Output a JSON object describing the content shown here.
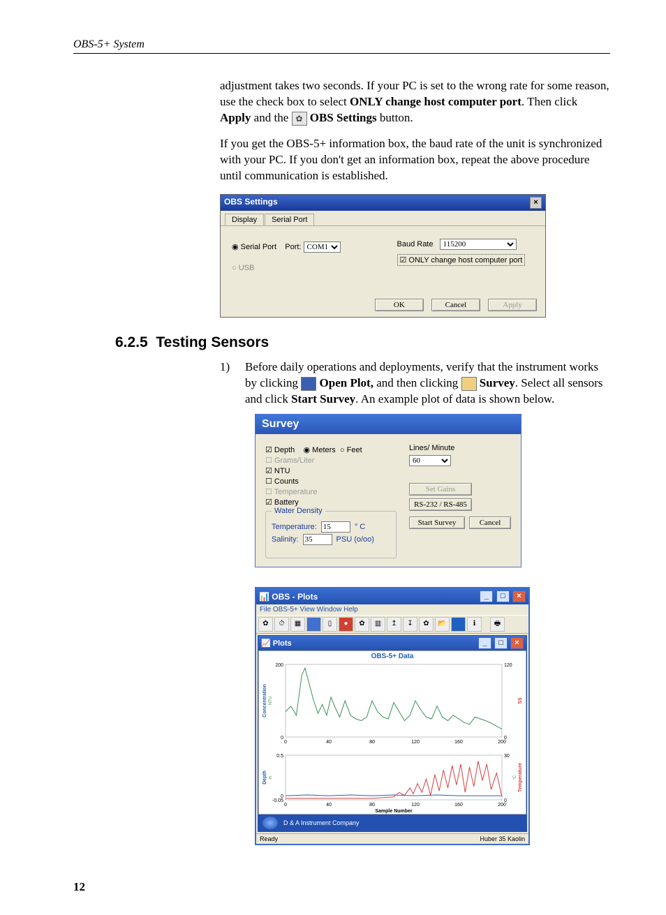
{
  "running_head": "OBS-5+ System",
  "para1_a": "adjustment takes two seconds.  If your PC is set to the wrong rate for some reason, use the check box to select ",
  "para1_b": "ONLY change host computer port",
  "para1_c": ".  Then click ",
  "para1_d": "Apply",
  "para1_e": " and the ",
  "para1_f": "OBS Settings",
  "para1_g": " button.",
  "para2": "If you get the OBS-5+ information box, the baud rate of the unit is synchronized with your PC.  If you don't get an information box, repeat the above procedure until communication is established.",
  "section_num": "6.2.5",
  "section_title": "Testing Sensors",
  "list1_num": "1)",
  "list1_a": "Before daily operations and deployments, verify that the instrument works by clicking ",
  "list1_b": "Open Plot,",
  "list1_c": " and then clicking ",
  "list1_d": "Survey",
  "list1_e": ".  Select all sensors and click ",
  "list1_f": "Start Survey",
  "list1_g": ".  An example plot of data is shown below.",
  "page_number": "12",
  "obs": {
    "title": "OBS Settings",
    "tab1": "Display",
    "tab2": "Serial Port",
    "r_serial": "Serial Port",
    "port_label": "Port:",
    "port_value": "COM1",
    "r_usb": "USB",
    "baud_label": "Baud Rate",
    "baud_value": "115200",
    "only_chk": "ONLY change host computer port",
    "ok": "OK",
    "cancel": "Cancel",
    "apply": "Apply"
  },
  "survey": {
    "title": "Survey",
    "depth": "Depth",
    "meters": "Meters",
    "feet": "Feet",
    "grams": "Grams/Liter",
    "ntu": "NTU",
    "counts": "Counts",
    "temperature": "Temperature",
    "battery": "Battery",
    "lpm": "Lines/ Minute",
    "lpm_val": "60",
    "setgains": "Set Gains",
    "rs": "RS-232 / RS-485",
    "start": "Start Survey",
    "cancel": "Cancel",
    "wd": "Water Density",
    "temp_l": "Temperature:",
    "temp_v": "15",
    "temp_u": "° C",
    "sal_l": "Salinity:",
    "sal_v": "35",
    "sal_u": "PSU (o/oo)"
  },
  "plots": {
    "title": "OBS - Plots",
    "menus": "File   OBS-5+   View   Window   Help",
    "sub_title": "Plots",
    "chart_title": "OBS-5+ Data",
    "footer": "D & A Instrument Company",
    "status_l": "Ready",
    "status_r": "Huber 35 Kaolin",
    "ylabel1": "Concentration",
    "ylabel1b": "NTU",
    "ylabel2": "Depth",
    "ylabel2b": "m",
    "ylabel3": "SS",
    "ylabel4": "Temperature",
    "ylabel4b": "°C",
    "xlabel": "Sample Number"
  },
  "chart_data": [
    {
      "type": "line",
      "title": "OBS-5+ Data — Concentration (NTU)",
      "xlabel": "Sample Number",
      "ylabel": "Concentration NTU",
      "xlim": [
        0,
        200
      ],
      "ylim_left": [
        0,
        200
      ],
      "ylim_right": [
        0,
        120
      ],
      "xticks": [
        0,
        40,
        80,
        120,
        160,
        200
      ],
      "yticks_left": [
        0,
        200
      ],
      "yticks_right": [
        0,
        120
      ],
      "series": [
        {
          "name": "Concentration",
          "color": "#3a8f5a",
          "x": [
            0,
            5,
            10,
            15,
            18,
            22,
            26,
            30,
            34,
            38,
            42,
            46,
            50,
            55,
            60,
            65,
            70,
            75,
            80,
            85,
            90,
            95,
            100,
            105,
            110,
            115,
            120,
            125,
            130,
            135,
            140,
            145,
            150,
            155,
            160,
            165,
            170,
            175,
            180,
            185,
            190,
            195,
            200
          ],
          "y": [
            70,
            85,
            60,
            170,
            190,
            145,
            100,
            65,
            90,
            60,
            110,
            80,
            55,
            100,
            60,
            50,
            45,
            55,
            100,
            70,
            55,
            50,
            95,
            70,
            45,
            60,
            100,
            75,
            55,
            50,
            85,
            55,
            45,
            60,
            50,
            40,
            35,
            55,
            50,
            45,
            38,
            30,
            22
          ]
        }
      ]
    },
    {
      "type": "line",
      "title": "OBS-5+ Data — Depth & Temperature",
      "xlabel": "Sample Number",
      "ylabel_left": "Depth m",
      "ylabel_right": "Temperature °C",
      "xlim": [
        0,
        200
      ],
      "ylim_left": [
        -0.05,
        0.5
      ],
      "ylim_right": [
        0,
        30
      ],
      "xticks": [
        0,
        40,
        80,
        120,
        160,
        200
      ],
      "series": [
        {
          "name": "Depth",
          "color": "#2060c0",
          "x": [
            0,
            20,
            40,
            60,
            80,
            100,
            120,
            140,
            160,
            180,
            200
          ],
          "y": [
            0.0,
            0.01,
            0.0,
            0.01,
            0.0,
            0.01,
            0.0,
            0.01,
            0.0,
            0.0,
            0.0
          ]
        },
        {
          "name": "Temperature",
          "color": "#d04040",
          "x": [
            0,
            20,
            40,
            60,
            80,
            100,
            105,
            110,
            115,
            118,
            122,
            126,
            130,
            134,
            138,
            142,
            146,
            150,
            154,
            158,
            162,
            166,
            170,
            174,
            178,
            182,
            186,
            190,
            195,
            200
          ],
          "y": [
            1,
            1,
            1,
            1,
            1,
            2,
            5,
            3,
            8,
            4,
            11,
            5,
            14,
            3,
            17,
            6,
            20,
            8,
            23,
            10,
            24,
            5,
            22,
            9,
            26,
            13,
            24,
            7,
            18,
            2
          ]
        }
      ]
    }
  ]
}
